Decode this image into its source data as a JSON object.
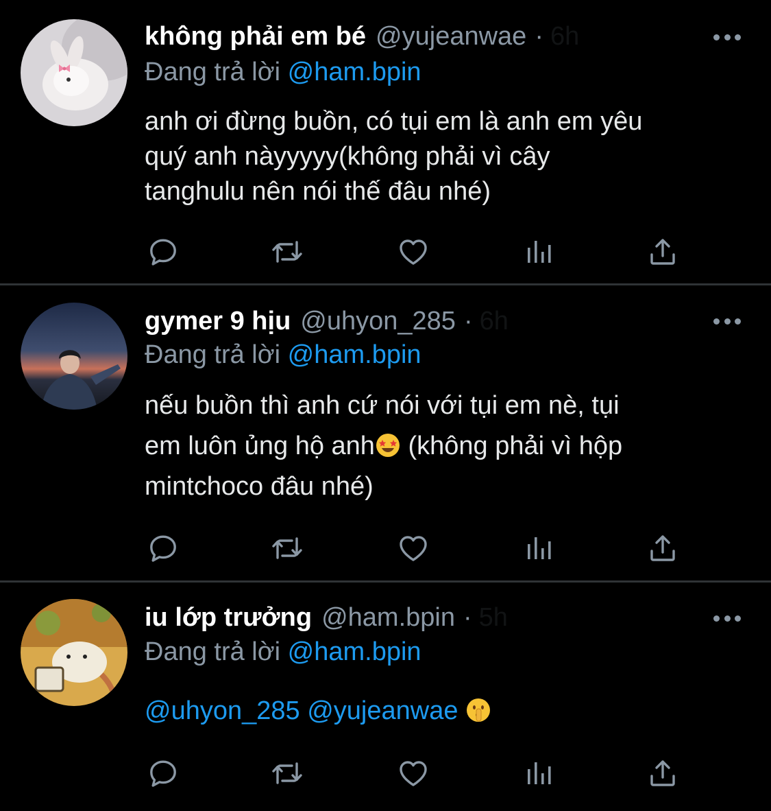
{
  "tweets": [
    {
      "display_name": "không phải em bé",
      "handle": "@yujeanwae",
      "separator": "·",
      "time": "6h",
      "reply_label": "Đang trả lời",
      "reply_to": "@ham.bpin",
      "lines": [
        "anh ơi đừng buồn, có tụi em là anh em yêu",
        "quý anh nàyyyyy(không phải vì cây",
        "tanghulu nên nói thế đâu nhé)"
      ],
      "avatar_icon": "bunny-avatar"
    },
    {
      "display_name": "gymer 9 hịu",
      "handle": "@uhyon_285",
      "separator": "·",
      "time": "6h",
      "reply_label": "Đang trả lời",
      "reply_to": "@ham.bpin",
      "line1": "nếu buồn thì anh cứ nói với tụi em nè, tụi",
      "line2_a": "em luôn ủng hộ anh",
      "line2_b": " (không phải vì hộp",
      "line3": "mintchoco đâu nhé)",
      "emoji_icon": "star-struck-emoji",
      "avatar_icon": "sunset-person-avatar"
    },
    {
      "display_name": "iu lớp trưởng",
      "handle": "@ham.bpin",
      "separator": "·",
      "time": "5h",
      "reply_label": "Đang trả lời",
      "reply_to": "@ham.bpin",
      "mention1": "@uhyon_285",
      "mention2": "@yujeanwae",
      "emoji_icon": "shushing-face-emoji",
      "avatar_icon": "hamster-avatar"
    }
  ],
  "action_icons": [
    "reply-icon",
    "retweet-icon",
    "like-icon",
    "analytics-icon",
    "share-icon"
  ],
  "colors": {
    "background": "#000000",
    "text": "#e7e9ea",
    "secondary": "#8b98a5",
    "link": "#1d9bf0",
    "divider": "#2f3336"
  }
}
